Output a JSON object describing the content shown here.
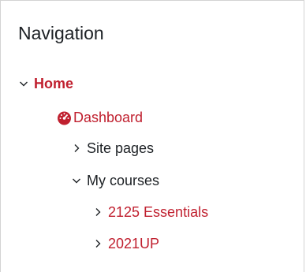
{
  "block": {
    "title": "Navigation"
  },
  "nav": {
    "home": {
      "label": "Home",
      "expanded": true,
      "icon": "chevron-down-icon"
    },
    "dashboard": {
      "label": "Dashboard",
      "icon": "dashboard-icon"
    },
    "site_pages": {
      "label": "Site pages",
      "expanded": false,
      "icon": "chevron-right-icon"
    },
    "my_courses": {
      "label": "My courses",
      "expanded": true,
      "icon": "chevron-down-icon"
    },
    "courses": [
      {
        "label": "2125 Essentials",
        "expanded": false,
        "icon": "chevron-right-icon"
      },
      {
        "label": "2021UP",
        "expanded": false,
        "icon": "chevron-right-icon"
      }
    ]
  },
  "colors": {
    "accent": "#c0202f",
    "text": "#1d2125",
    "border": "#d3d3d3"
  }
}
